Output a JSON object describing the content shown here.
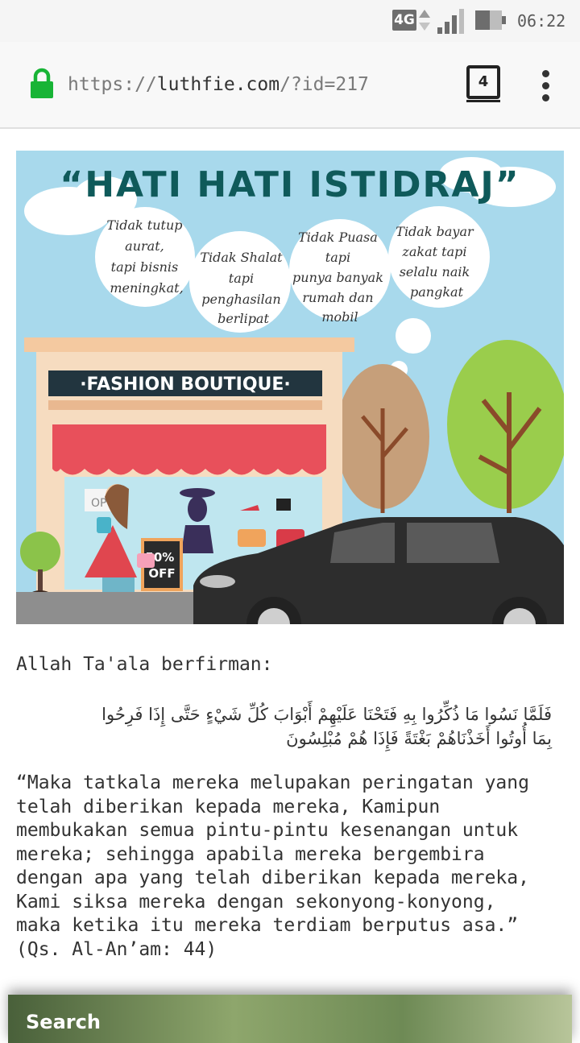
{
  "status_bar": {
    "network": "4G",
    "time": "06:22"
  },
  "browser": {
    "url_scheme": "https://",
    "url_host": "luthfie.com",
    "url_path": "/?id=217",
    "tab_count": "4"
  },
  "hero_image": {
    "title": "“HATI HATI ISTIDRAJ”",
    "bubbles": [
      [
        "Tidak tutup",
        "aurat,",
        "tapi bisnis",
        "meningkat,"
      ],
      [
        "Tidak Shalat",
        "tapi",
        "penghasilan",
        "berlipat"
      ],
      [
        "Tidak Puasa",
        "tapi",
        "punya banyak",
        "rumah dan",
        "mobil"
      ],
      [
        "Tidak bayar",
        "zakat tapi",
        "selalu naik",
        "pangkat"
      ]
    ],
    "shop_sign": "·FASHION BOUTIQUE·",
    "door_sign": "OP",
    "sale_sign": [
      "50%",
      "OFF"
    ]
  },
  "article": {
    "intro": "Allah Ta'ala berfirman:",
    "arabic_line1": "فَلَمَّا نَسُوا مَا ذُكِّرُوا بِهِ فَتَحْنَا عَلَيْهِمْ أَبْوَابَ كُلِّ شَيْءٍ حَتَّى إِذَا فَرِحُوا",
    "arabic_line2": "بِمَا أُوتُوا أَخَذْنَاهُمْ بَغْتَةً فَإِذَا هُمْ مُبْلِسُونَ",
    "translation_lines": [
      "“Maka tatkala mereka melupakan peringatan yang",
      "telah diberikan kepada mereka, Kamipun",
      "membukakan semua pintu-pintu kesenangan untuk",
      "mereka; sehingga apabila mereka bergembira",
      "dengan apa yang telah diberikan kepada mereka,",
      "Kami siksa mereka dengan sekonyong-konyong,",
      "maka ketika itu mereka terdiam berputus asa.”",
      "(Qs. Al-An’am: 44)"
    ]
  },
  "search_widget": {
    "title": "Search"
  }
}
